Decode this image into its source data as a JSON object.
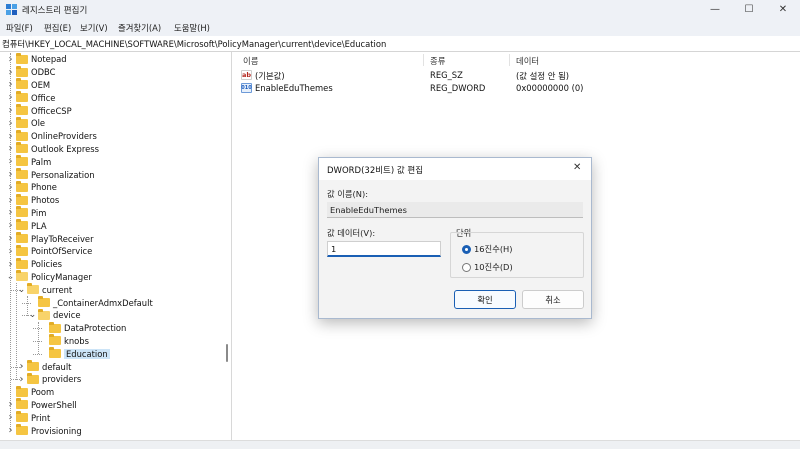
{
  "window": {
    "title": "레지스트리 편집기",
    "minimize_glyph": "—",
    "maximize_glyph": "☐",
    "close_glyph": "✕"
  },
  "menu": [
    "파일(F)",
    "편집(E)",
    "보기(V)",
    "즐겨찾기(A)",
    "도움말(H)"
  ],
  "address": {
    "path": "컴퓨터\\HKEY_LOCAL_MACHINE\\SOFTWARE\\Microsoft\\PolicyManager\\current\\device\\Education"
  },
  "tree": {
    "items": [
      {
        "label": "Notepad",
        "level": 0,
        "expander": "collapsed"
      },
      {
        "label": "ODBC",
        "level": 0,
        "expander": "collapsed"
      },
      {
        "label": "OEM",
        "level": 0,
        "expander": "collapsed"
      },
      {
        "label": "Office",
        "level": 0,
        "expander": "collapsed"
      },
      {
        "label": "OfficeCSP",
        "level": 0,
        "expander": "collapsed"
      },
      {
        "label": "Ole",
        "level": 0,
        "expander": "collapsed"
      },
      {
        "label": "OnlineProviders",
        "level": 0,
        "expander": "collapsed"
      },
      {
        "label": "Outlook Express",
        "level": 0,
        "expander": "collapsed"
      },
      {
        "label": "Palm",
        "level": 0,
        "expander": "collapsed"
      },
      {
        "label": "Personalization",
        "level": 0,
        "expander": "collapsed"
      },
      {
        "label": "Phone",
        "level": 0,
        "expander": "collapsed"
      },
      {
        "label": "Photos",
        "level": 0,
        "expander": "collapsed"
      },
      {
        "label": "Pim",
        "level": 0,
        "expander": "collapsed"
      },
      {
        "label": "PLA",
        "level": 0,
        "expander": "collapsed"
      },
      {
        "label": "PlayToReceiver",
        "level": 0,
        "expander": "collapsed"
      },
      {
        "label": "PointOfService",
        "level": 0,
        "expander": "collapsed"
      },
      {
        "label": "Policies",
        "level": 0,
        "expander": "collapsed"
      },
      {
        "label": "PolicyManager",
        "level": 0,
        "expander": "expanded"
      },
      {
        "label": "current",
        "level": 1,
        "expander": "expanded"
      },
      {
        "label": "_ContainerAdmxDefault",
        "level": 2,
        "expander": "none"
      },
      {
        "label": "device",
        "level": 2,
        "expander": "expanded"
      },
      {
        "label": "DataProtection",
        "level": 3,
        "expander": "none"
      },
      {
        "label": "knobs",
        "level": 3,
        "expander": "none"
      },
      {
        "label": "Education",
        "level": 3,
        "expander": "none",
        "selected": true
      },
      {
        "label": "default",
        "level": 1,
        "expander": "collapsed"
      },
      {
        "label": "providers",
        "level": 1,
        "expander": "collapsed"
      },
      {
        "label": "Poom",
        "level": 0,
        "expander": "none"
      },
      {
        "label": "PowerShell",
        "level": 0,
        "expander": "collapsed"
      },
      {
        "label": "Print",
        "level": 0,
        "expander": "collapsed"
      },
      {
        "label": "Provisioning",
        "level": 0,
        "expander": "collapsed"
      }
    ]
  },
  "list": {
    "headers": {
      "name": "이름",
      "type": "종류",
      "data": "데이터"
    },
    "rows": [
      {
        "icon": "string-value-icon",
        "icon_text": "ab",
        "name": "(기본값)",
        "type": "REG_SZ",
        "data": "(값 설정 안 됨)"
      },
      {
        "icon": "dword-value-icon",
        "icon_text": "010",
        "name": "EnableEduThemes",
        "type": "REG_DWORD",
        "data": "0x00000000 (0)"
      }
    ]
  },
  "dialog": {
    "title": "DWORD(32비트) 값 편집",
    "name_label": "값 이름(N):",
    "name_value": "EnableEduThemes",
    "data_label": "값 데이터(V):",
    "data_value": "1",
    "unit_label": "단위",
    "radio_hex": "16진수(H)",
    "radio_dec": "10진수(D)",
    "selected_base": "hex",
    "ok_label": "확인",
    "cancel_label": "취소"
  },
  "colors": {
    "selection": "#cce4f7",
    "accent": "#1a5fb4",
    "folder": "#f5c542"
  }
}
